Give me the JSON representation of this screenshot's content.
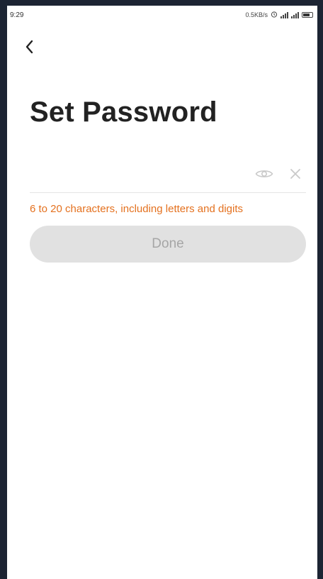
{
  "status_bar": {
    "time": "9:29",
    "network_speed": "0.5KB/s"
  },
  "header": {
    "back_icon": "chevron-left-icon"
  },
  "page": {
    "title": "Set Password"
  },
  "password_field": {
    "value": "",
    "placeholder": "",
    "visibility_icon": "eye-icon",
    "clear_icon": "close-icon"
  },
  "hint": "6 to 20 characters, including letters and digits",
  "done_button": {
    "label": "Done"
  },
  "colors": {
    "hint": "#e4711f",
    "button_disabled_bg": "#e1e1e1",
    "button_disabled_text": "#a6a6a6",
    "title": "#222222"
  }
}
